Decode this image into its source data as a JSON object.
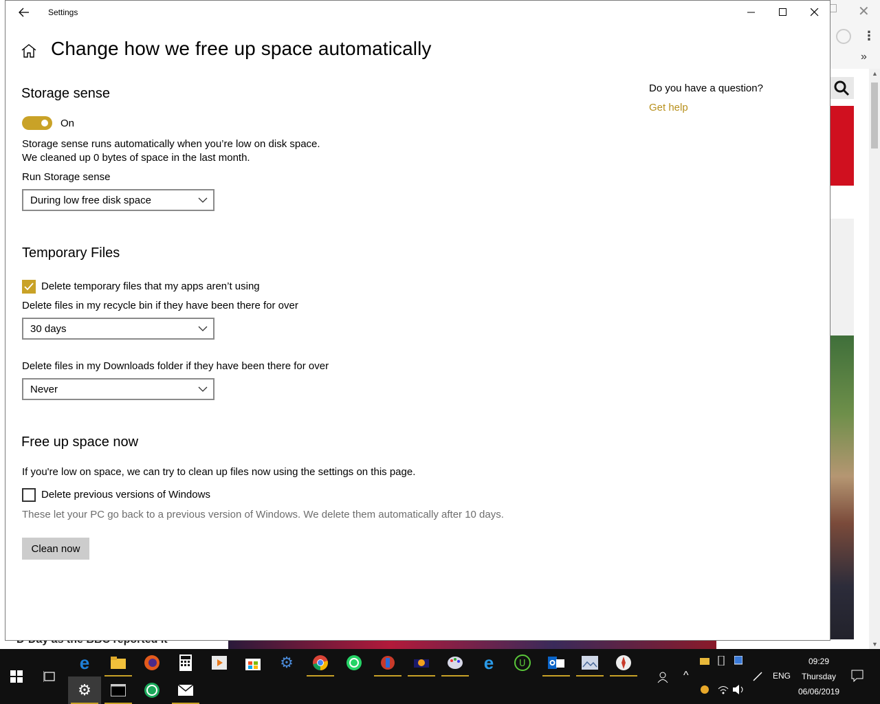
{
  "window": {
    "title": "Settings",
    "page_title": "Change how we free up space automatically"
  },
  "storage_sense": {
    "heading": "Storage sense",
    "toggle_state": "On",
    "toggle_on": true,
    "desc_line1": "Storage sense runs automatically when you’re low on disk space.",
    "desc_line2": "We cleaned up 0 bytes of space in the last month.",
    "run_label": "Run Storage sense",
    "run_value": "During low free disk space"
  },
  "temporary_files": {
    "heading": "Temporary Files",
    "delete_temp_label": "Delete temporary files that my apps aren’t using",
    "delete_temp_checked": true,
    "recycle_label": "Delete files in my recycle bin if they have been there for over",
    "recycle_value": "30 days",
    "downloads_label": "Delete files in my Downloads folder if they have been there for over",
    "downloads_value": "Never"
  },
  "free_up_now": {
    "heading": "Free up space now",
    "desc": "If you're low on space, we can try to clean up files now using the settings on this page.",
    "prev_windows_label": "Delete previous versions of Windows",
    "prev_windows_checked": false,
    "prev_windows_note": "These let your PC go back to a previous version of Windows. We delete them automatically after 10 days.",
    "clean_button": "Clean now"
  },
  "help": {
    "question": "Do you have a question?",
    "link": "Get help"
  },
  "background_page": {
    "bottom_text": "D-Day as the BBC reported it"
  },
  "taskbar": {
    "language": "ENG",
    "time": "09:29",
    "day": "Thursday",
    "date": "06/06/2019"
  },
  "colors": {
    "accent": "#c9a227",
    "link": "#b8901c",
    "taskbar": "#101010"
  }
}
